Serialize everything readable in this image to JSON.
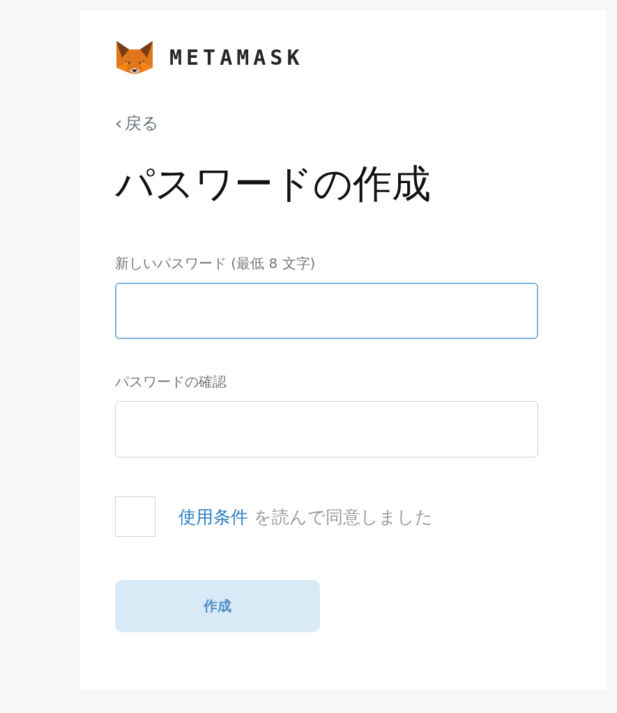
{
  "logo": {
    "wordmark": "METAMASK"
  },
  "back_link": {
    "chevron": "‹",
    "label": "戻る"
  },
  "title": "パスワードの作成",
  "fields": [
    {
      "label": "新しいパスワード (最低 8 文字)",
      "focused": true
    },
    {
      "label": "パスワードの確認",
      "focused": false
    }
  ],
  "terms": {
    "checked": false,
    "link": "使用条件",
    "text": "を読んで同意しました"
  },
  "create_button": {
    "label": "作成",
    "disabled": true
  }
}
